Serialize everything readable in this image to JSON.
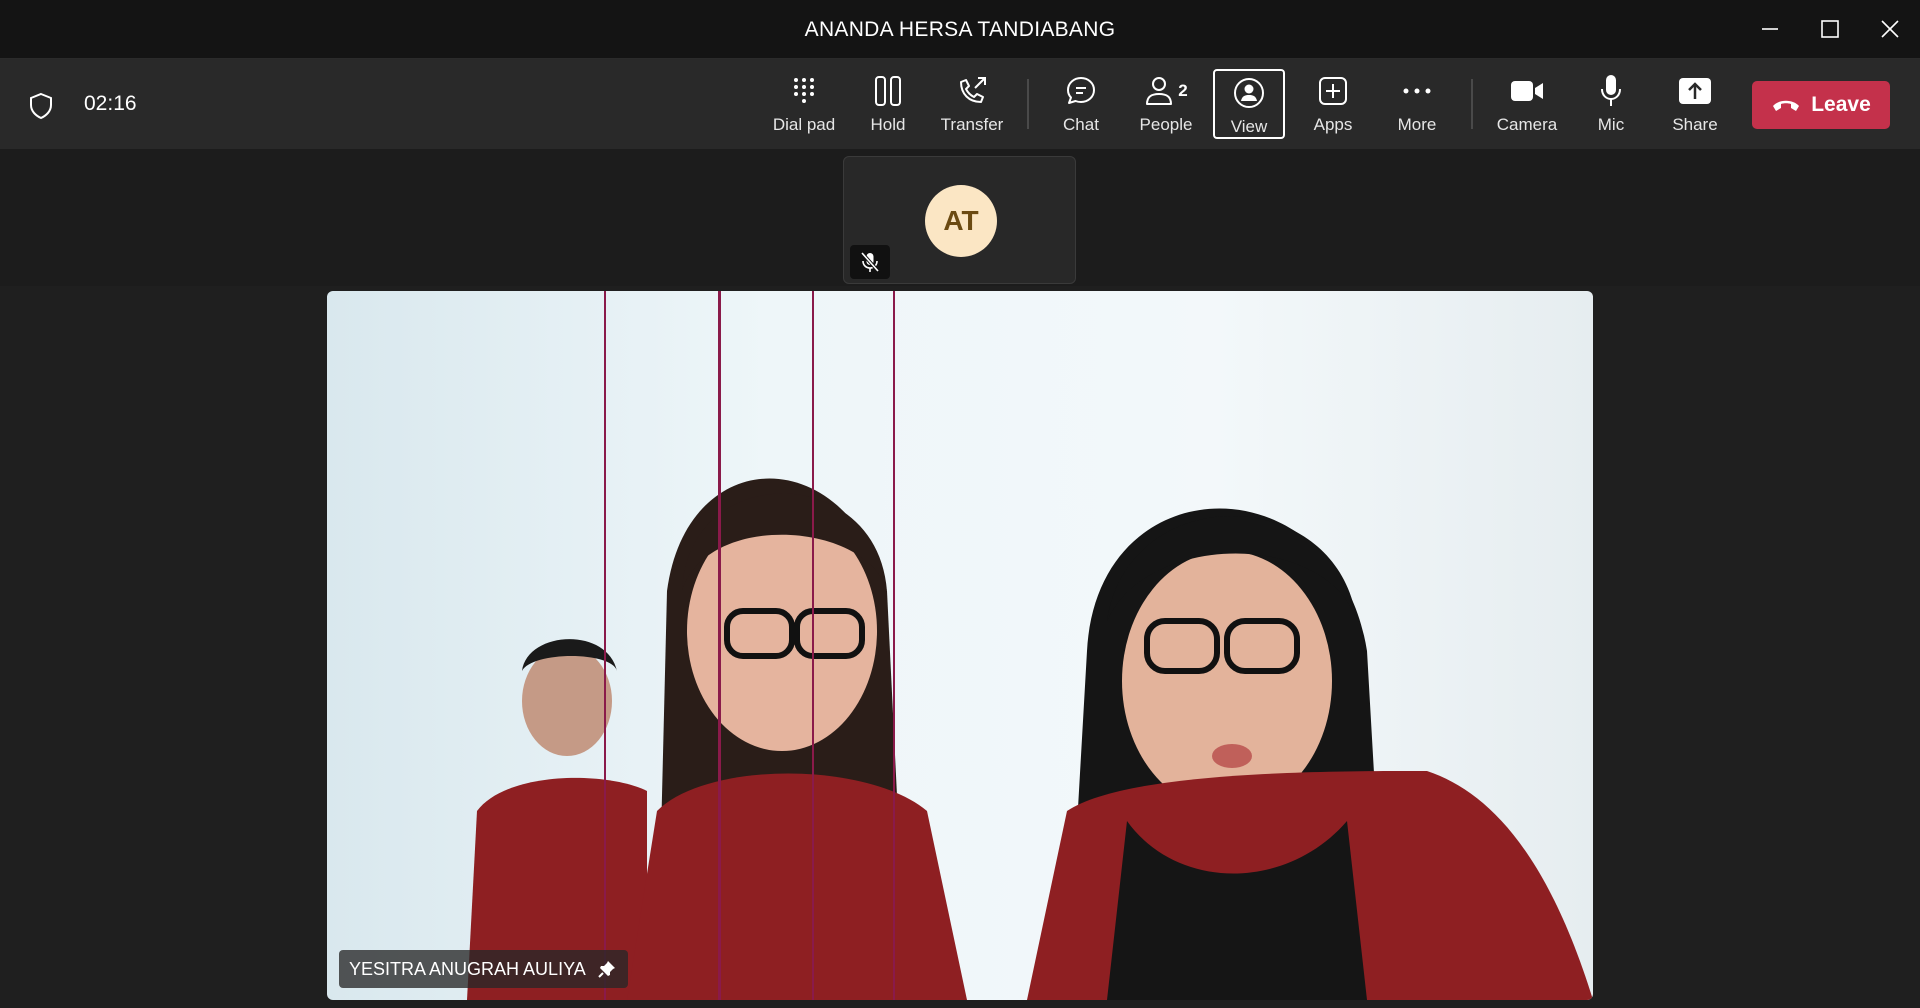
{
  "window": {
    "title": "ANANDA HERSA TANDIABANG",
    "controls": [
      "minimize-icon",
      "maximize-icon",
      "close-icon"
    ]
  },
  "toolbar": {
    "security_icon": "shield-icon",
    "timer": "02:16",
    "buttons": [
      {
        "label": "Dial pad",
        "icon": "dialpad-icon"
      },
      {
        "label": "Hold",
        "icon": "hold-icon"
      },
      {
        "label": "Transfer",
        "icon": "transfer-icon"
      },
      {
        "label": "Chat",
        "icon": "chat-icon"
      },
      {
        "label": "People",
        "icon": "people-icon",
        "count": "2"
      },
      {
        "label": "View",
        "icon": "view-icon",
        "selected": true
      },
      {
        "label": "Apps",
        "icon": "apps-icon"
      },
      {
        "label": "More",
        "icon": "more-icon"
      },
      {
        "label": "Camera",
        "icon": "camera-icon"
      },
      {
        "label": "Mic",
        "icon": "mic-icon"
      },
      {
        "label": "Share",
        "icon": "share-icon"
      }
    ],
    "leave": {
      "label": "Leave",
      "icon": "hangup-icon",
      "color": "#c4314b"
    }
  },
  "participants": {
    "self_tile": {
      "initials": "AT",
      "muted": true,
      "avatar_color": "#fbe6c4"
    },
    "main_video": {
      "name": "YESITRA ANUGRAH AULIYA",
      "pinned": true
    }
  }
}
